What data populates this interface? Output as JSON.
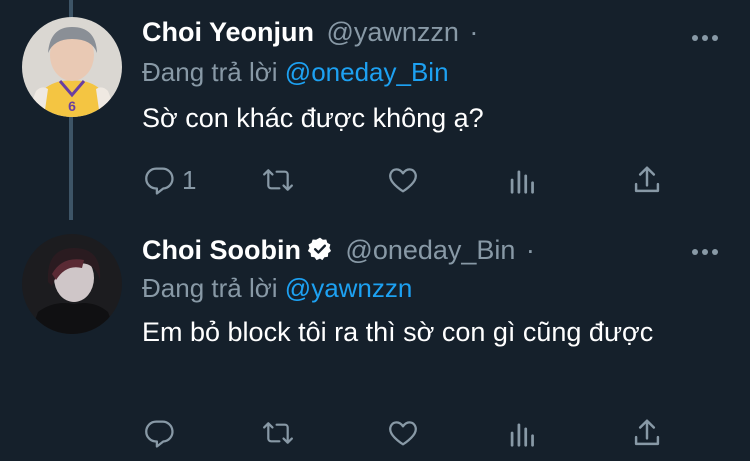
{
  "tweets": [
    {
      "display_name": "Choi Yeonjun",
      "handle": "@yawnzzn",
      "separator": "·",
      "replying_prefix": "Đang trả lời",
      "replying_to": "@oneday_Bin",
      "text": "Sờ con khác được không ạ?",
      "reply_count": "1",
      "verified": false
    },
    {
      "display_name": "Choi Soobin",
      "handle": "@oneday_Bin",
      "separator": "·",
      "replying_prefix": "Đang trả lời",
      "replying_to": "@yawnzzn",
      "text": "Em bỏ block tôi ra thì sờ con gì cũng được",
      "reply_count": "",
      "verified": true
    }
  ],
  "colors": {
    "background": "#15202b",
    "secondary_text": "#8899a6",
    "accent": "#1da1f2"
  },
  "icons": [
    "reply-icon",
    "retweet-icon",
    "like-icon",
    "stats-icon",
    "share-icon",
    "more-icon",
    "verified-icon"
  ]
}
